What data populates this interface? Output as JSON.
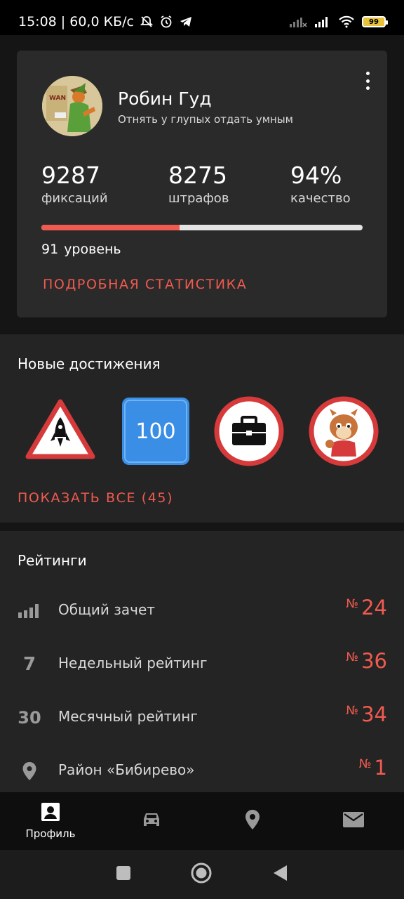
{
  "status_bar": {
    "time_speed": "15:08 | 60,0 КБ/с",
    "battery": "99",
    "icons": [
      "bell-off-icon",
      "alarm-icon",
      "telegram-icon",
      "signal-icon",
      "signal-icon",
      "wifi-icon",
      "battery-icon"
    ]
  },
  "profile": {
    "name": "Робин Гуд",
    "motto": "Отнять у глупых отдать умным",
    "stats": [
      {
        "value": "9287",
        "label": "фиксаций"
      },
      {
        "value": "8275",
        "label": "штрафов"
      },
      {
        "value": "94%",
        "label": "качество"
      }
    ],
    "level_progress": 0.43,
    "level_number": "91",
    "level_label": "уровень",
    "details_link": "ПОДРОБНАЯ СТАТИСТИКА"
  },
  "achievements": {
    "title": "Новые достижения",
    "badge_100_text": "100",
    "badges": [
      "rocket-warning-badge",
      "hundred-badge",
      "briefcase-sign-badge",
      "chipmunk-badge"
    ],
    "show_all": "ПОКАЗАТЬ ВСЕ (45)"
  },
  "ratings": {
    "title": "Рейтинги",
    "no_sign": "№",
    "rows": [
      {
        "icon": "signal-bars-icon",
        "icon_text": "",
        "label": "Общий зачет",
        "value": "24"
      },
      {
        "icon": "seven-icon",
        "icon_text": "7",
        "label": "Недельный рейтинг",
        "value": "36"
      },
      {
        "icon": "thirty-icon",
        "icon_text": "30",
        "label": "Месячный рейтинг",
        "value": "34"
      },
      {
        "icon": "location-pin-icon",
        "icon_text": "",
        "label": "Район «Бибирево»",
        "value": "1"
      }
    ]
  },
  "bottom_nav": {
    "items": [
      {
        "icon": "profile-icon",
        "label": "Профиль"
      },
      {
        "icon": "car-icon",
        "label": ""
      },
      {
        "icon": "map-pin-icon",
        "label": ""
      },
      {
        "icon": "mail-icon",
        "label": ""
      }
    ]
  },
  "colors": {
    "accent": "#f05a50",
    "card": "#2a2a2a",
    "section": "#242424",
    "badge_blue": "#3a8ee6"
  }
}
